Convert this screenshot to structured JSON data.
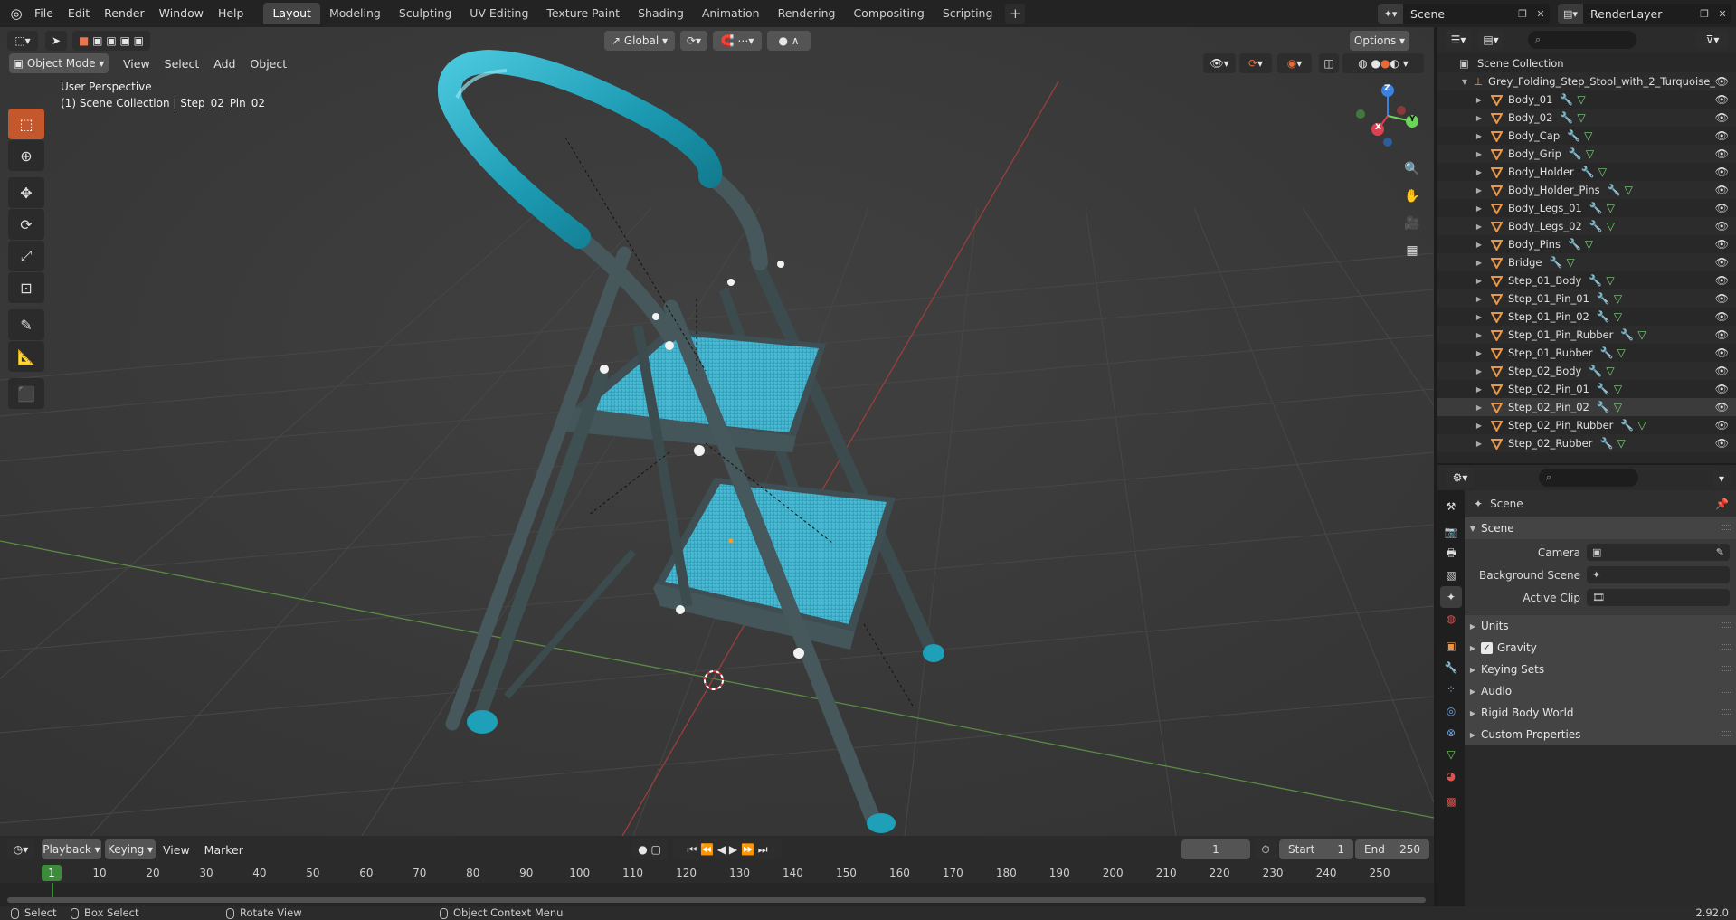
{
  "topbar": {
    "menus": [
      "File",
      "Edit",
      "Render",
      "Window",
      "Help"
    ],
    "workspaces": [
      "Layout",
      "Modeling",
      "Sculpting",
      "UV Editing",
      "Texture Paint",
      "Shading",
      "Animation",
      "Rendering",
      "Compositing",
      "Scripting"
    ],
    "active_workspace": "Layout",
    "add_label": "+",
    "scene_name": "Scene",
    "view_layer": "RenderLayer"
  },
  "viewport": {
    "mode": "Object Mode",
    "menus": [
      "View",
      "Select",
      "Add",
      "Object"
    ],
    "orientation": "Global",
    "options_label": "Options",
    "perspective_label": "User Perspective",
    "collection_label": "(1) Scene Collection | Step_02_Pin_02",
    "gizmo": {
      "x": "X",
      "y": "Y",
      "z": "Z"
    }
  },
  "timeline": {
    "menus": [
      "Playback",
      "Keying",
      "View",
      "Marker"
    ],
    "current_frame": "1",
    "start_label": "Start",
    "start_value": "1",
    "end_label": "End",
    "end_value": "250",
    "ruler": [
      "1",
      "10",
      "20",
      "30",
      "40",
      "50",
      "60",
      "70",
      "80",
      "90",
      "100",
      "110",
      "120",
      "130",
      "140",
      "150",
      "160",
      "170",
      "180",
      "190",
      "200",
      "210",
      "220",
      "230",
      "240",
      "250"
    ]
  },
  "statusbar": {
    "select": "Select",
    "box_select": "Box Select",
    "rotate_view": "Rotate View",
    "context_menu": "Object Context Menu",
    "version": "2.92.0"
  },
  "outliner": {
    "scene_collection": "Scene Collection",
    "root": "Grey_Folding_Step_Stool_with_2_Turquoise_",
    "items": [
      "Body_01",
      "Body_02",
      "Body_Cap",
      "Body_Grip",
      "Body_Holder",
      "Body_Holder_Pins",
      "Body_Legs_01",
      "Body_Legs_02",
      "Body_Pins",
      "Bridge",
      "Step_01_Body",
      "Step_01_Pin_01",
      "Step_01_Pin_02",
      "Step_01_Pin_Rubber",
      "Step_01_Rubber",
      "Step_02_Body",
      "Step_02_Pin_01",
      "Step_02_Pin_02",
      "Step_02_Pin_Rubber",
      "Step_02_Rubber"
    ],
    "selected": "Step_02_Pin_02"
  },
  "properties": {
    "context": "Scene",
    "panel_scene": "Scene",
    "camera_label": "Camera",
    "background_scene_label": "Background Scene",
    "active_clip_label": "Active Clip",
    "panels": [
      "Units",
      "Gravity",
      "Keying Sets",
      "Audio",
      "Rigid Body World",
      "Custom Properties"
    ]
  },
  "colors": {
    "accent_active_tool": "#c5572c",
    "turquoise": "#1ea0b8",
    "x_axis": "#e0404f",
    "y_axis": "#6bd45a",
    "z_axis": "#3b82e0"
  }
}
